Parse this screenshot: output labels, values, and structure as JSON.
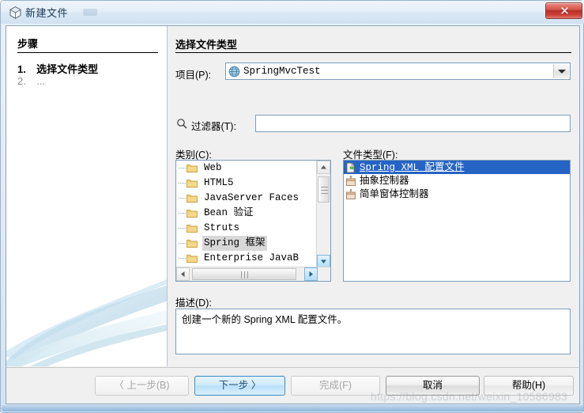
{
  "window": {
    "title": "新建文件",
    "title_icon": "cube-icon",
    "close_label": "✕",
    "accent_color": "#2563c4",
    "close_color": "#b92e28"
  },
  "left_pane": {
    "heading": "步骤",
    "steps": [
      {
        "num": "1.",
        "label": "选择文件类型",
        "active": true
      },
      {
        "num": "2.",
        "label": "...",
        "active": false
      }
    ]
  },
  "main": {
    "heading": "选择文件类型",
    "project": {
      "label": "项目(P):",
      "icon": "web-project-icon",
      "value": "SpringMvcTest",
      "arrow_icon": "chevron-down-icon"
    },
    "filter": {
      "icon": "search-icon",
      "label": "过滤器(T):",
      "value": "",
      "placeholder": ""
    },
    "category": {
      "label": "类别(C):",
      "items": [
        {
          "label": "Web",
          "icon": "folder-icon",
          "selected": false
        },
        {
          "label": "HTML5",
          "icon": "folder-icon",
          "selected": false
        },
        {
          "label": "JavaServer Faces",
          "icon": "folder-icon",
          "selected": false
        },
        {
          "label": "Bean 验证",
          "icon": "folder-icon",
          "selected": false
        },
        {
          "label": "Struts",
          "icon": "folder-icon",
          "selected": false
        },
        {
          "label": "Spring 框架",
          "icon": "folder-icon",
          "selected": true
        },
        {
          "label": "Enterprise JavaB",
          "icon": "folder-icon",
          "selected": false
        }
      ]
    },
    "file_type": {
      "label": "文件类型(F):",
      "items": [
        {
          "label": "Spring XML 配置文件",
          "icon": "spring-xml-file-icon",
          "selected": true
        },
        {
          "label": "抽象控制器",
          "icon": "controller-file-icon",
          "selected": false
        },
        {
          "label": "简单窗体控制器",
          "icon": "controller-file-icon",
          "selected": false
        }
      ]
    },
    "description": {
      "label": "描述(D):",
      "text": "创建一个新的 Spring XML 配置文件。"
    }
  },
  "buttons": {
    "prev": {
      "label": "〈 上一步(B)",
      "state": "disabled"
    },
    "next": {
      "label": "下一步 〉",
      "state": "default"
    },
    "finish": {
      "label": "完成(F)",
      "state": "disabled"
    },
    "cancel": {
      "label": "取消",
      "state": "normal"
    },
    "help": {
      "label": "帮助(H)",
      "state": "normal"
    }
  },
  "watermark": {
    "text": "https://blog.csdn.net/weixin_10586983"
  }
}
